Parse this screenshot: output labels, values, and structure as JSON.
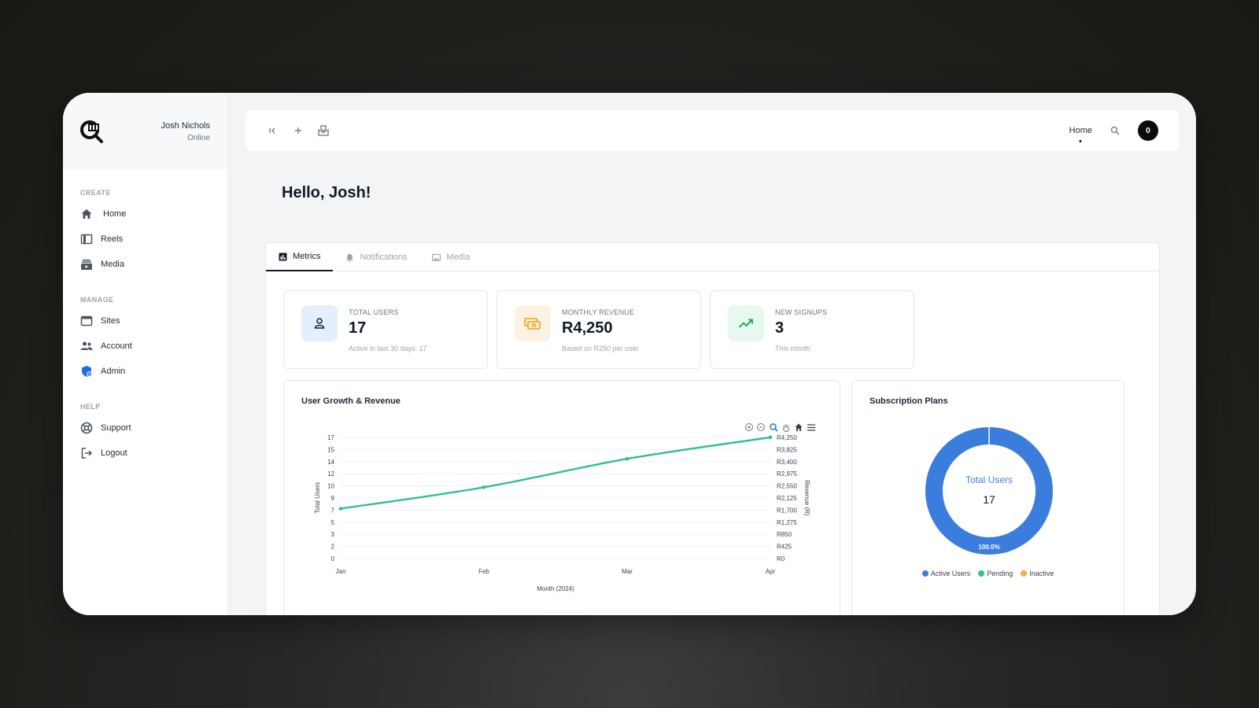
{
  "user": {
    "name": "Josh Nichols",
    "status": "Online",
    "initial": "0"
  },
  "sidebar": {
    "sections": [
      {
        "label": "CREATE",
        "items": [
          {
            "label": "Home",
            "icon": "home-icon"
          },
          {
            "label": "Reels",
            "icon": "reels-icon"
          },
          {
            "label": "Media",
            "icon": "media-icon"
          }
        ]
      },
      {
        "label": "MANAGE",
        "items": [
          {
            "label": "Sites",
            "icon": "sites-icon"
          },
          {
            "label": "Account",
            "icon": "account-icon"
          },
          {
            "label": "Admin",
            "icon": "admin-shield-icon"
          }
        ]
      },
      {
        "label": "HELP",
        "items": [
          {
            "label": "Support",
            "icon": "support-icon"
          },
          {
            "label": "Logout",
            "icon": "logout-icon"
          }
        ]
      }
    ]
  },
  "topbar": {
    "home_label": "Home"
  },
  "greeting": "Hello, Josh!",
  "tabs": [
    {
      "label": "Metrics"
    },
    {
      "label": "Notifications"
    },
    {
      "label": "Media"
    }
  ],
  "stats": [
    {
      "label": "TOTAL USERS",
      "value": "17",
      "sub": "Active in last 30 days: 17",
      "icon": "user-icon",
      "bg": "#e3effc",
      "fg": "#1f2937"
    },
    {
      "label": "MONTHLY REVENUE",
      "value": "R4,250",
      "sub": "Based on R250 per user",
      "icon": "money-icon",
      "bg": "#fdf1e3",
      "fg": "#f59e0b"
    },
    {
      "label": "NEW SIGNUPS",
      "value": "3",
      "sub": "This month",
      "icon": "trend-up-icon",
      "bg": "#e7f8ee",
      "fg": "#16a34a"
    }
  ],
  "charts": {
    "growth_title": "User Growth & Revenue",
    "plans_title": "Subscription Plans"
  },
  "chart_data": [
    {
      "type": "line",
      "title": "User Growth & Revenue",
      "xlabel": "Month (2024)",
      "ylabel": "Total Users",
      "y2label": "Revenue (R)",
      "categories": [
        "Jan",
        "Feb",
        "Mar",
        "Apr"
      ],
      "ylim": [
        0,
        17
      ],
      "y2lim": [
        0,
        4250
      ],
      "yticks": [
        "0",
        "2",
        "3",
        "5",
        "7",
        "9",
        "10",
        "12",
        "14",
        "15",
        "17"
      ],
      "y2ticks": [
        "R0",
        "R425",
        "R850",
        "R1,275",
        "R1,700",
        "R2,125",
        "R2,550",
        "R2,975",
        "R3,400",
        "R3,825",
        "R4,250"
      ],
      "series": [
        {
          "values": [
            7,
            10,
            14,
            17
          ],
          "axis": "left",
          "color": "#3b6fd4"
        },
        {
          "values": [
            1750,
            2500,
            3500,
            4250
          ],
          "axis": "right",
          "color": "#2ec48a"
        }
      ]
    },
    {
      "type": "pie",
      "title": "Subscription Plans",
      "center_label": "Total Users",
      "center_value": "17",
      "slice_label": "100.0%",
      "categories": [
        "Active Users",
        "Pending",
        "Inactive"
      ],
      "values": [
        17,
        0,
        0
      ],
      "colors": [
        "#3b7ddd",
        "#34c38f",
        "#f5b041"
      ]
    }
  ]
}
